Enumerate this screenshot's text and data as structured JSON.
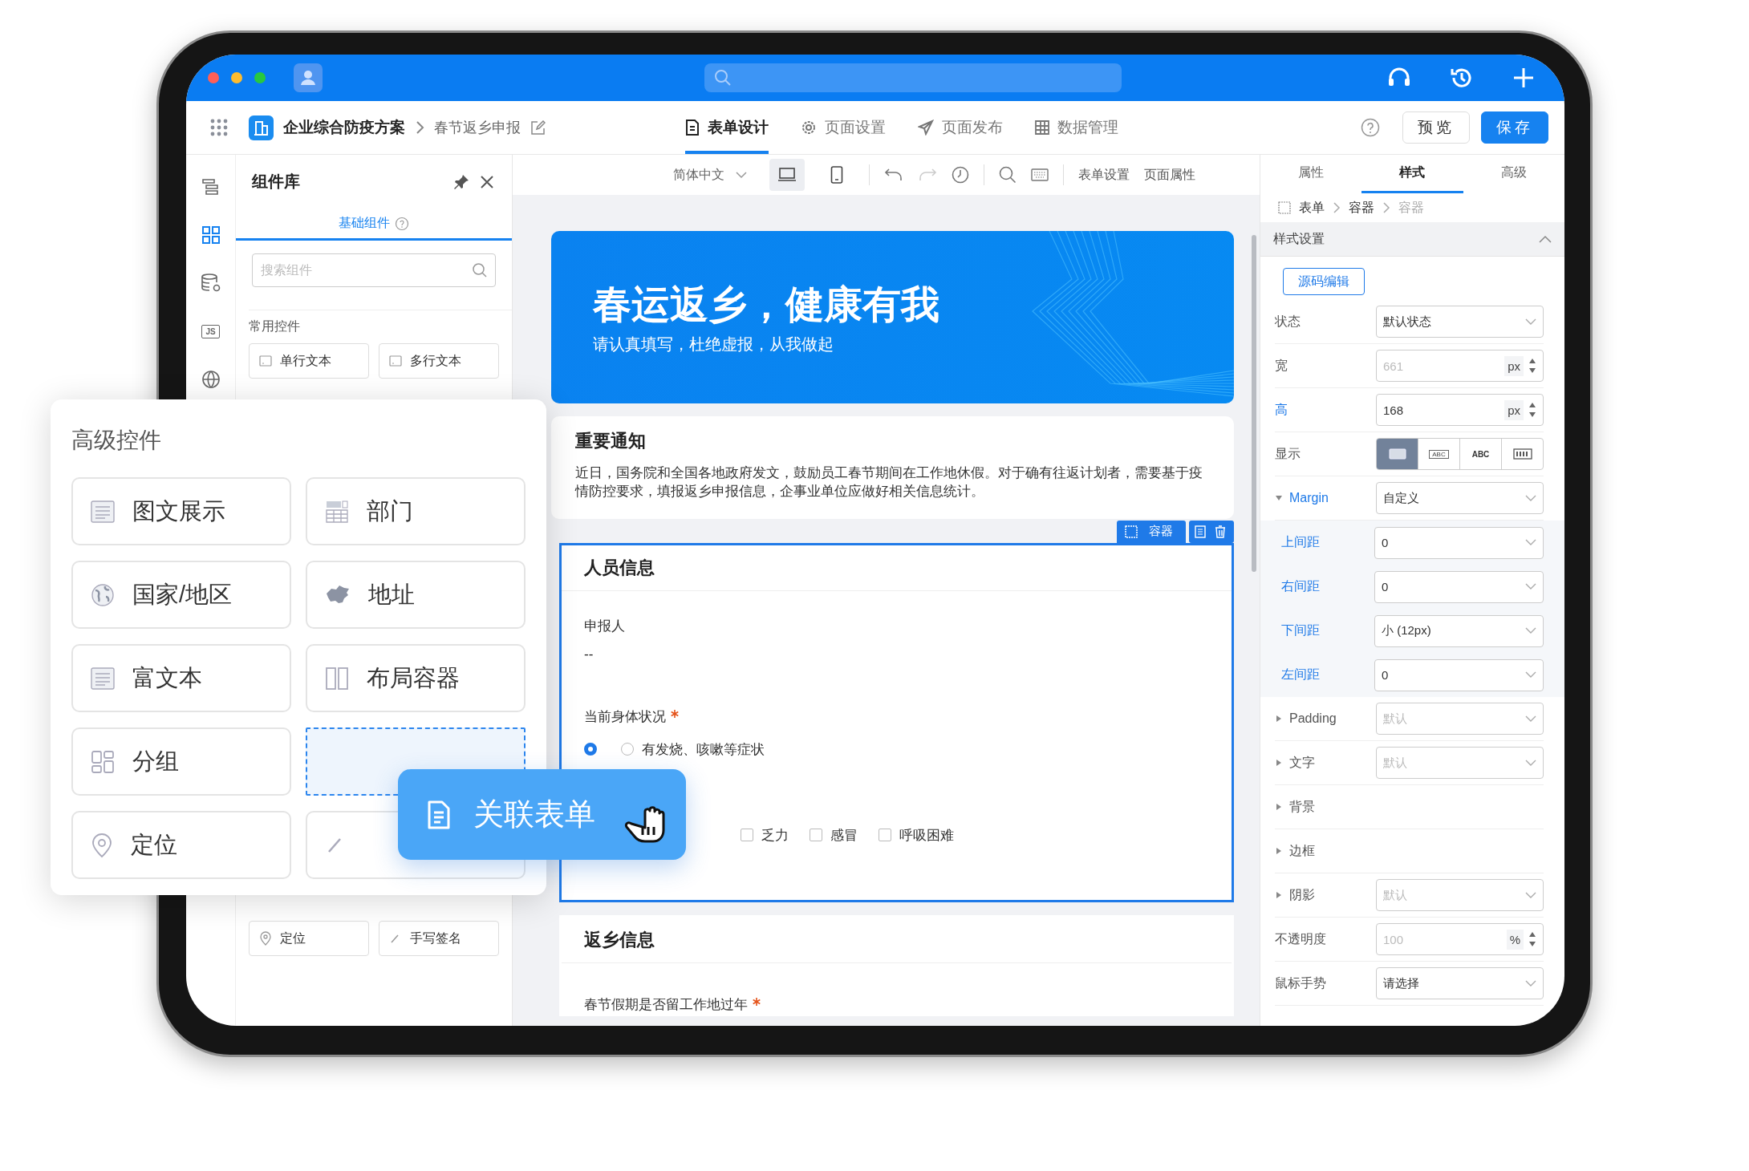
{
  "nav": {
    "breadcrumb": [
      "企业综合防疫方案",
      "春节返乡申报"
    ],
    "tabs": [
      {
        "label": "表单设计",
        "kind": "form",
        "selected": true
      },
      {
        "label": "页面设置",
        "kind": "settings",
        "selected": false
      },
      {
        "label": "页面发布",
        "kind": "publish",
        "selected": false
      },
      {
        "label": "数据管理",
        "kind": "data",
        "selected": false
      }
    ],
    "buttons": [
      {
        "label": "预览",
        "kind": "secondary"
      },
      {
        "label": "保存",
        "kind": "primary"
      }
    ]
  },
  "rail": [
    {
      "kind": "outline",
      "selected": false
    },
    {
      "kind": "grid",
      "selected": true
    },
    {
      "kind": "database",
      "selected": false
    },
    {
      "kind": "js",
      "label": "JS",
      "selected": false
    },
    {
      "kind": "globe",
      "selected": false
    }
  ],
  "component_panel": {
    "title": "组件库",
    "tabs": [
      {
        "label": "基础组件",
        "selected": true
      }
    ],
    "search": {
      "placeholder": "搜索组件"
    },
    "section": "常用控件",
    "items_top": [
      {
        "label": "单行文本",
        "kind": "input"
      },
      {
        "label": "多行文本",
        "kind": "input"
      }
    ],
    "items_bottom": [
      {
        "label": "定位",
        "kind": "location"
      },
      {
        "label": "手写签名",
        "kind": "signature"
      }
    ]
  },
  "advanced_popup": {
    "title": "高级控件",
    "items": [
      {
        "label": "图文展示",
        "kind": "article"
      },
      {
        "label": "部门",
        "kind": "department"
      },
      {
        "label": "国家/地区",
        "kind": "globe"
      },
      {
        "label": "地址",
        "kind": "map"
      },
      {
        "label": "富文本",
        "kind": "article"
      },
      {
        "label": "布局容器",
        "kind": "columns"
      },
      {
        "label": "分组",
        "kind": "group"
      },
      {
        "kind": "slot"
      },
      {
        "label": "定位",
        "kind": "location"
      },
      {
        "kind": "signature"
      }
    ]
  },
  "drag_ghost": {
    "label": "关联表单"
  },
  "toolbar": {
    "language": "简体中文",
    "devices": [
      {
        "kind": "desktop",
        "selected": true
      },
      {
        "kind": "mobile",
        "selected": false
      }
    ],
    "actions": [
      "表单设置",
      "页面属性"
    ]
  },
  "form": {
    "banner": {
      "title": "春运返乡，健康有我",
      "subtitle": "请认真填写，杜绝虚报，从我做起"
    },
    "notice": {
      "title": "重要通知",
      "text": "近日，国务院和全国各地政府发文，鼓励员工春节期间在工作地休假。对于确有往返计划者，需要基于疫情防控要求，填报返乡申报信息，企事业单位应做好相关信息统计。"
    },
    "selection": {
      "label": "容器"
    },
    "sections": [
      {
        "title": "人员信息",
        "selected": true,
        "fields": [
          {
            "kind": "text",
            "label": "申报人",
            "required": false,
            "value": "--"
          },
          {
            "kind": "radio",
            "label": "当前身体状况",
            "required": true,
            "options": [
              {
                "selected": true
              },
              {
                "label": "有发烧、咳嗽等症状",
                "selected": false
              }
            ]
          },
          {
            "kind": "checkbox",
            "options": [
              {
                "label": "乏力",
                "checked": false
              },
              {
                "label": "感冒",
                "checked": false
              },
              {
                "label": "呼吸困难",
                "checked": false
              }
            ]
          }
        ]
      },
      {
        "title": "返乡信息",
        "selected": false,
        "fields": [
          {
            "kind": "radio",
            "label": "春节假期是否留工作地过年",
            "required": true
          }
        ]
      }
    ]
  },
  "style_panel": {
    "tabs": [
      {
        "label": "属性",
        "selected": false
      },
      {
        "label": "样式",
        "selected": true
      },
      {
        "label": "高级",
        "selected": false
      }
    ],
    "breadcrumb": [
      {
        "label": "表单",
        "current": false
      },
      {
        "label": "容器",
        "current": false
      },
      {
        "label": "容器",
        "current": true
      }
    ],
    "section": "样式设置",
    "source_button": "源码编辑",
    "rows": [
      {
        "kind": "select",
        "label": "状态",
        "value": "默认状态",
        "modified": false
      },
      {
        "kind": "number",
        "label": "宽",
        "placeholder": "661",
        "unit": "px",
        "modified": false
      },
      {
        "kind": "number",
        "label": "高",
        "value": "168",
        "unit": "px",
        "modified": true
      },
      {
        "kind": "segmented",
        "label": "显示",
        "modified": false,
        "options": [
          {
            "kind": "block",
            "selected": true
          },
          {
            "kind": "inline",
            "label": "ABC",
            "selected": false
          },
          {
            "kind": "text",
            "label": "ABC",
            "selected": false
          },
          {
            "kind": "flex",
            "selected": false
          }
        ]
      },
      {
        "kind": "group",
        "label": "Margin",
        "value": "自定义",
        "expanded": true,
        "modified": true,
        "children": [
          {
            "label": "上间距",
            "value": "0",
            "modified": true
          },
          {
            "label": "右间距",
            "value": "0",
            "modified": true
          },
          {
            "label": "下间距",
            "value": "小 (12px)",
            "modified": true
          },
          {
            "label": "左间距",
            "value": "0",
            "modified": true
          }
        ]
      },
      {
        "kind": "group",
        "label": "Padding",
        "placeholder": "默认",
        "expanded": false,
        "modified": false
      },
      {
        "kind": "group",
        "label": "文字",
        "placeholder": "默认",
        "expanded": false,
        "modified": false
      },
      {
        "kind": "group",
        "label": "背景",
        "expanded": false,
        "modified": false
      },
      {
        "kind": "group",
        "label": "边框",
        "expanded": false,
        "modified": false
      },
      {
        "kind": "group",
        "label": "阴影",
        "placeholder": "默认",
        "expanded": false,
        "modified": false
      },
      {
        "kind": "number",
        "label": "不透明度",
        "placeholder": "100",
        "unit": "%",
        "modified": false
      },
      {
        "kind": "select",
        "label": "鼠标手势",
        "value": "请选择",
        "modified": false
      }
    ]
  }
}
